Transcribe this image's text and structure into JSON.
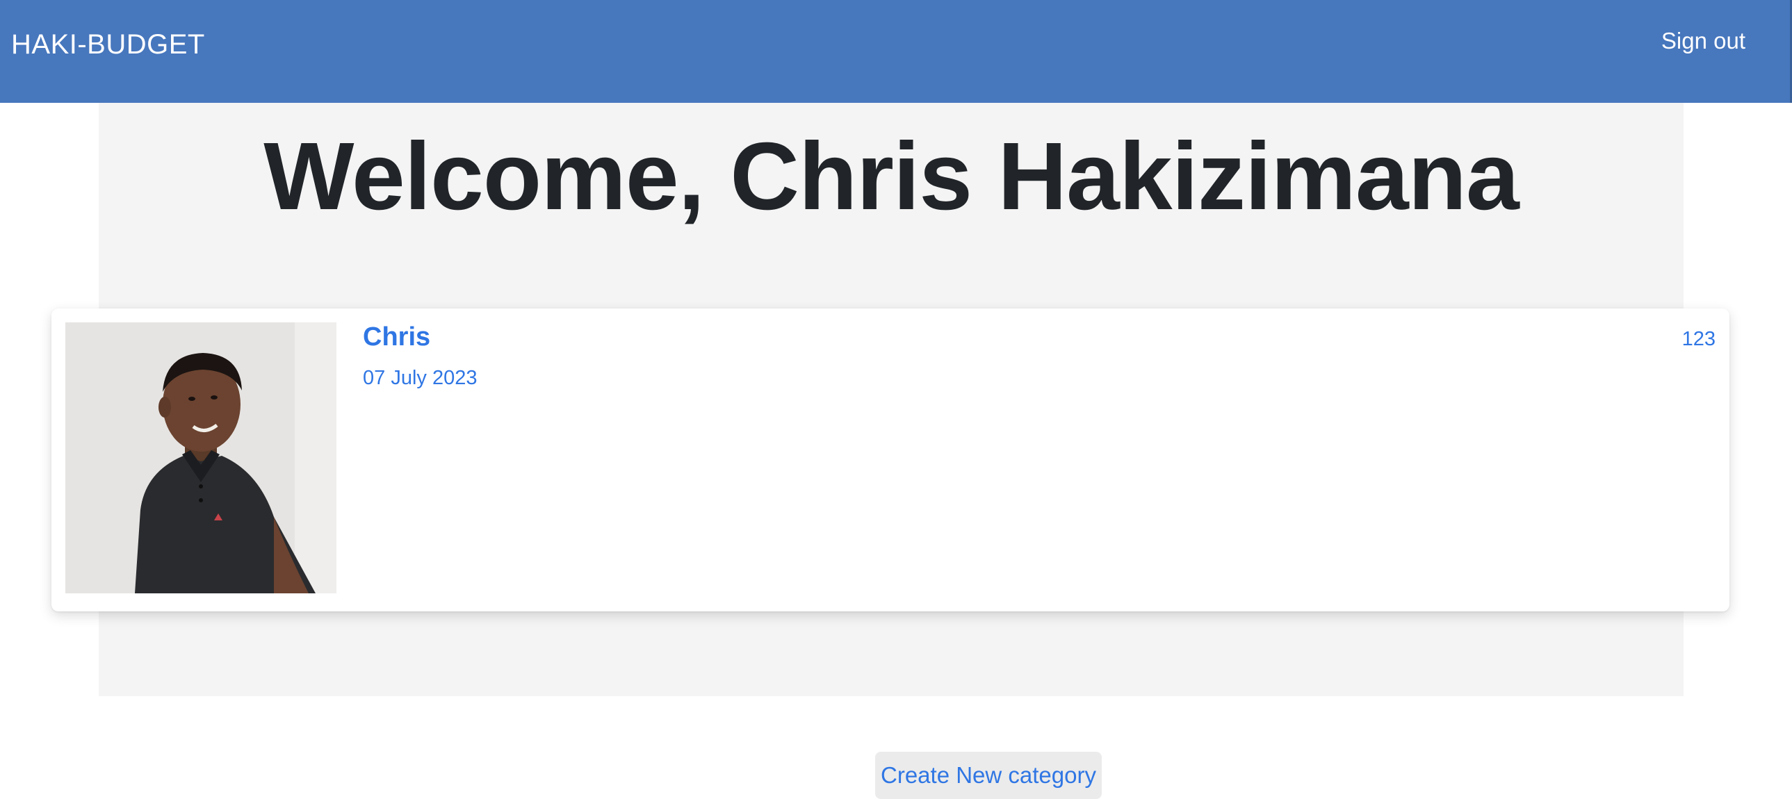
{
  "navbar": {
    "brand": "HAKI-BUDGET",
    "sign_out_label": "Sign out",
    "background_color": "#4777bd"
  },
  "welcome": {
    "heading": "Welcome, Chris Hakizimana"
  },
  "categories": [
    {
      "name": "Chris",
      "date": "07 July 2023",
      "amount": "123",
      "icon": "user-photo"
    }
  ],
  "actions": {
    "create_category_label": "Create New category"
  },
  "colors": {
    "accent": "#2f76e4",
    "heading": "#212529",
    "content_background": "#f4f4f4"
  }
}
